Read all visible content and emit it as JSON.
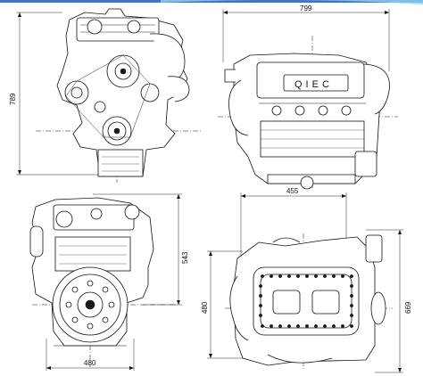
{
  "header": {
    "bar_color": "#3f73c3",
    "accent_color": "#8fd3f0"
  },
  "views": [
    {
      "id": "front",
      "dimensions": [
        {
          "label": "789"
        }
      ]
    },
    {
      "id": "side",
      "dimensions": [
        {
          "label": "799"
        }
      ],
      "engraved_text": "QIEC"
    },
    {
      "id": "rear",
      "dimensions": [
        {
          "label": "543"
        },
        {
          "label": "480"
        }
      ]
    },
    {
      "id": "top",
      "dimensions": [
        {
          "label": "455"
        },
        {
          "label": "480"
        },
        {
          "label": "669"
        }
      ]
    }
  ]
}
